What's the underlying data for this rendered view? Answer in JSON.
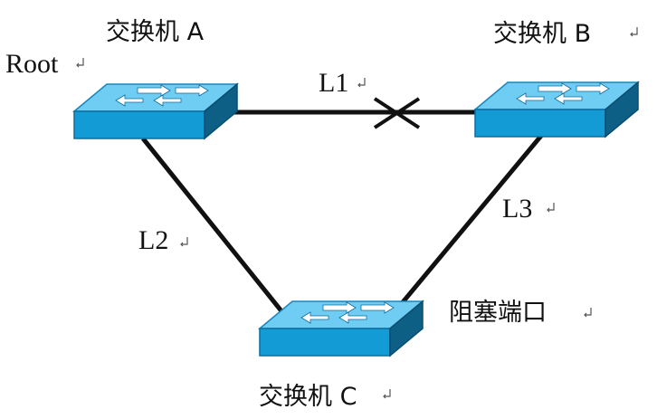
{
  "switches": {
    "a": {
      "label": "交换机 A",
      "role_label": "Root"
    },
    "b": {
      "label": "交换机 B"
    },
    "c": {
      "label": "交换机 C"
    }
  },
  "links": {
    "l1": {
      "label": "L1",
      "state": "blocked"
    },
    "l2": {
      "label": "L2"
    },
    "l3": {
      "label": "L3"
    }
  },
  "annotations": {
    "blocked_port": "阻塞端口"
  },
  "colors": {
    "switch_top": "#6fcdf3",
    "switch_front": "#139bd5",
    "switch_side": "#0d5f86",
    "line": "#111111",
    "label_text": "#111111",
    "return_mark": "#555555"
  }
}
